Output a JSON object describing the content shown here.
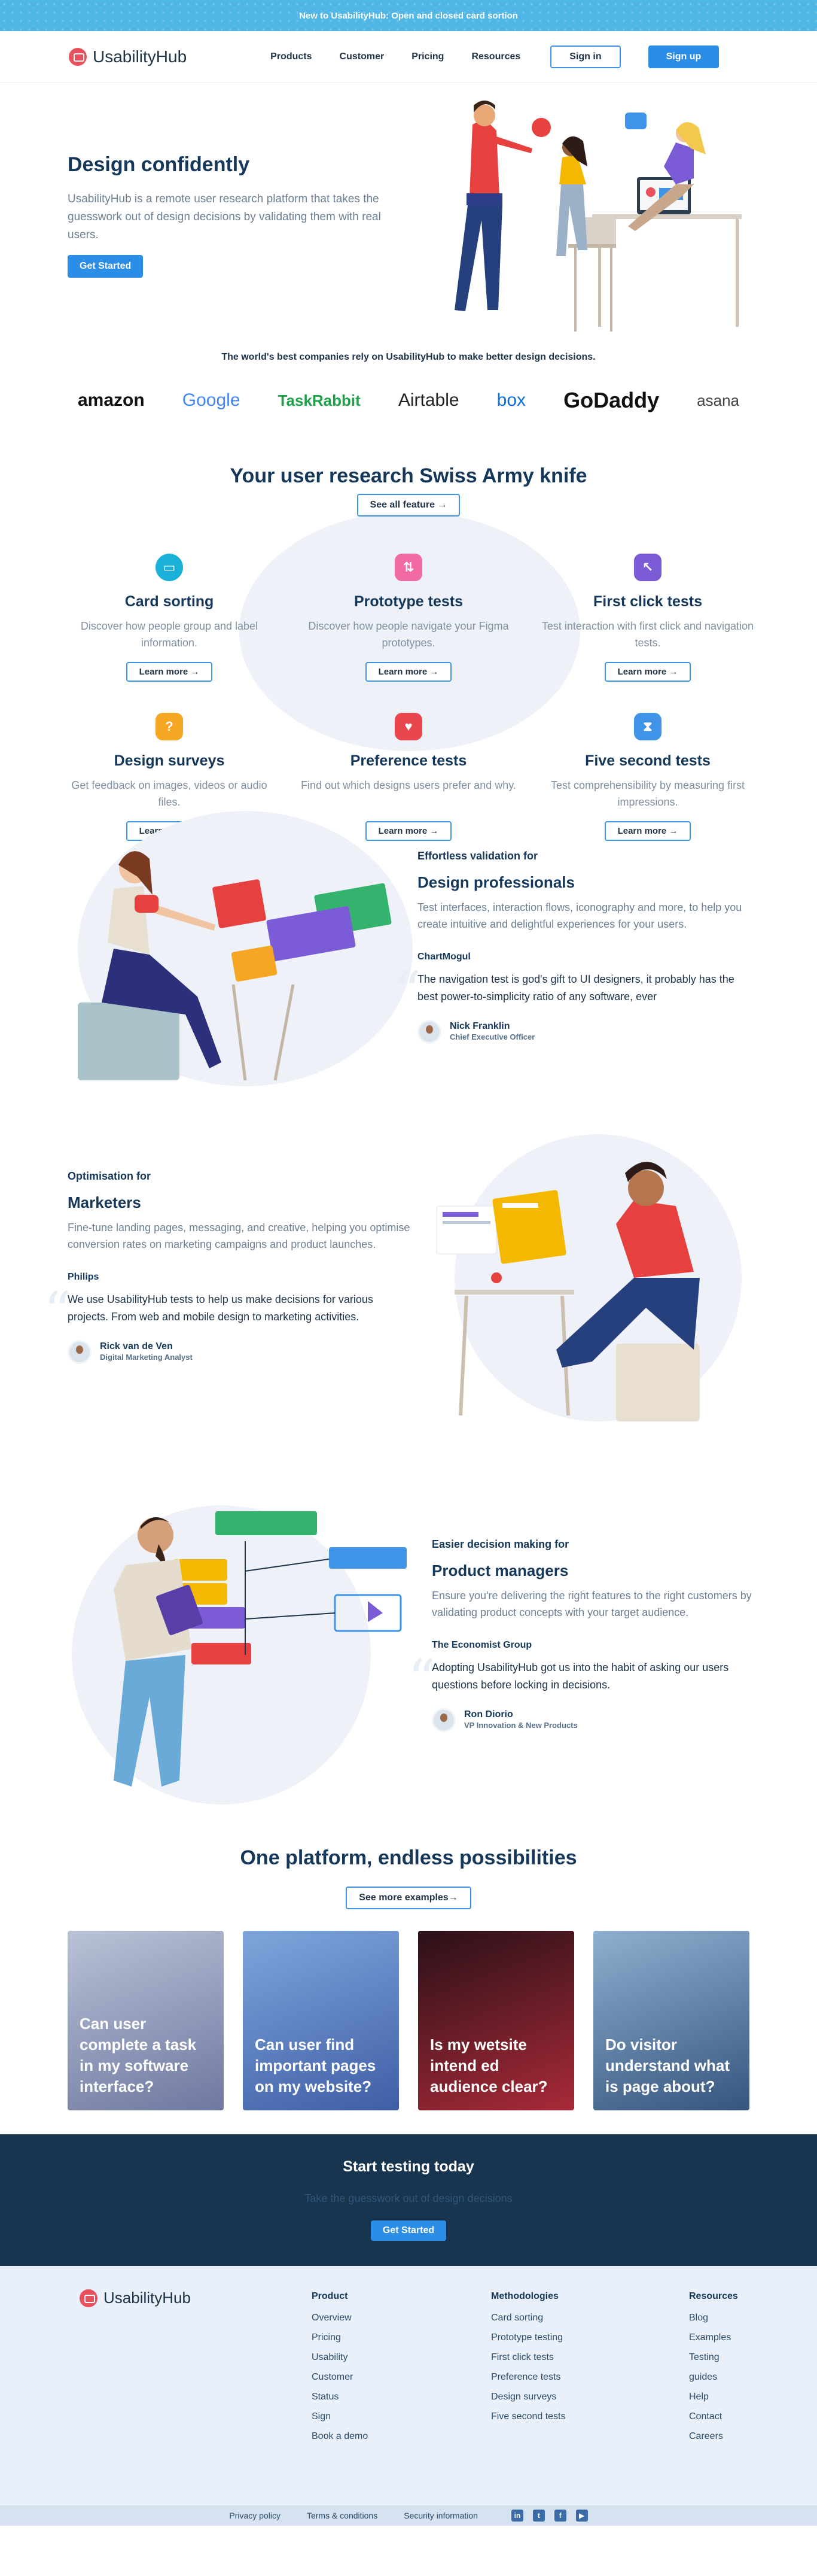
{
  "banner": {
    "text": "New to UsabilityHub: Open and closed card sortion"
  },
  "nav": {
    "brand": "UsabilityHub",
    "links": [
      "Products",
      "Customer",
      "Pricing",
      "Resources"
    ],
    "signin": "Sign in",
    "signup": "Sign up"
  },
  "hero": {
    "title": "Design confidently",
    "body": "UsabilityHub is a remote user research platform that takes the guesswork out of design decisions by validating them with real users.",
    "cta": "Get Started"
  },
  "trust": {
    "text": "The world's best companies rely on UsabilityHub to make better design decisions.",
    "logos": [
      "amazon",
      "Google",
      "TaskRabbit",
      "Airtable",
      "box",
      "GoDaddy",
      "asana"
    ]
  },
  "features": {
    "title": "Your user research Swiss Army knife",
    "all_btn": "See all feature →",
    "learn": "Learn more →",
    "items": [
      {
        "title": "Card sorting",
        "desc": "Discover how people group and label information.",
        "color": "#1ab1d8",
        "icon": "▭"
      },
      {
        "title": "Prototype tests",
        "desc": "Discover how people navigate your Figma prototypes.",
        "color": "#f26aa4",
        "icon": "⇅"
      },
      {
        "title": "First click tests",
        "desc": "Test interaction with first click and navigation tests.",
        "color": "#7c5cd6",
        "icon": "↖"
      },
      {
        "title": "Design surveys",
        "desc": "Get feedback on images, videos or audio files.",
        "color": "#f5a623",
        "icon": "?"
      },
      {
        "title": "Preference tests",
        "desc": "Find out which designs users prefer and why.",
        "color": "#e9474e",
        "icon": "♥"
      },
      {
        "title": "Five second tests",
        "desc": "Test comprehensibility by measuring first impressions.",
        "color": "#3f94e8",
        "icon": "⧗"
      }
    ]
  },
  "personas": [
    {
      "kicker": "Effortless validation for",
      "title": "Design professionals",
      "desc": "Test interfaces, interaction flows, iconography and more, to help you create intuitive and delightful experiences for your users.",
      "company": "ChartMogul",
      "quote": "The navigation test is god's gift to UI designers, it probably has the best power-to-simplicity ratio of any software, ever",
      "name": "Nick Franklin",
      "role": "Chief Executive Officer"
    },
    {
      "kicker": "Optimisation for",
      "title": "Marketers",
      "desc": "Fine-tune landing pages, messaging, and creative, helping you optimise conversion rates on marketing campaigns and product launches.",
      "company": "Philips",
      "quote": "We use UsabilityHub tests to help us make decisions for various projects. From web and mobile design to marketing activities.",
      "name": "Rick van de Ven",
      "role": "Digital Marketing Analyst"
    },
    {
      "kicker": "Easier decision making for",
      "title": "Product managers",
      "desc": "Ensure you're delivering the right features to the right customers by validating product concepts with your target audience.",
      "company": "The Economist Group",
      "quote": "Adopting UsabilityHub got us into the habit of asking our users questions before locking in decisions.",
      "name": "Ron Diorio",
      "role": "VP Innovation & New Products"
    }
  ],
  "examples": {
    "title": "One platform, endless possibilities",
    "btn": "See more examples→",
    "cards": [
      {
        "text": "Can user complete a task in my software interface?",
        "color": "#7e8aa8"
      },
      {
        "text": "Can user find important pages on my website?",
        "color": "#5274b4"
      },
      {
        "text": "Is my wetsite intend ed audience clear?",
        "color": "#8e2330"
      },
      {
        "text": "Do visitor understand what is page about?",
        "color": "#4a6d96"
      }
    ]
  },
  "cta": {
    "title": "Start testing today",
    "sub": "Take the guesswork out of design decisions",
    "btn": "Get Started"
  },
  "footer": {
    "brand": "UsabilityHub",
    "cols": [
      {
        "title": "Product",
        "links": [
          "Overview",
          "Pricing",
          "Usability",
          "Customer",
          "Status",
          "Sign",
          "Book a demo"
        ]
      },
      {
        "title": "Methodologies",
        "links": [
          "Card sorting",
          "Prototype testing",
          "First click tests",
          "Preference tests",
          "Design surveys",
          "Five second tests"
        ]
      },
      {
        "title": "Resources",
        "links": [
          "Blog",
          "Examples",
          "Testing",
          "guides",
          "Help",
          "Contact",
          "Careers"
        ]
      }
    ],
    "bottom": [
      "Privacy policy",
      "Terms & conditions",
      "Security information"
    ],
    "social": [
      "in",
      "t",
      "f",
      "▶"
    ]
  }
}
